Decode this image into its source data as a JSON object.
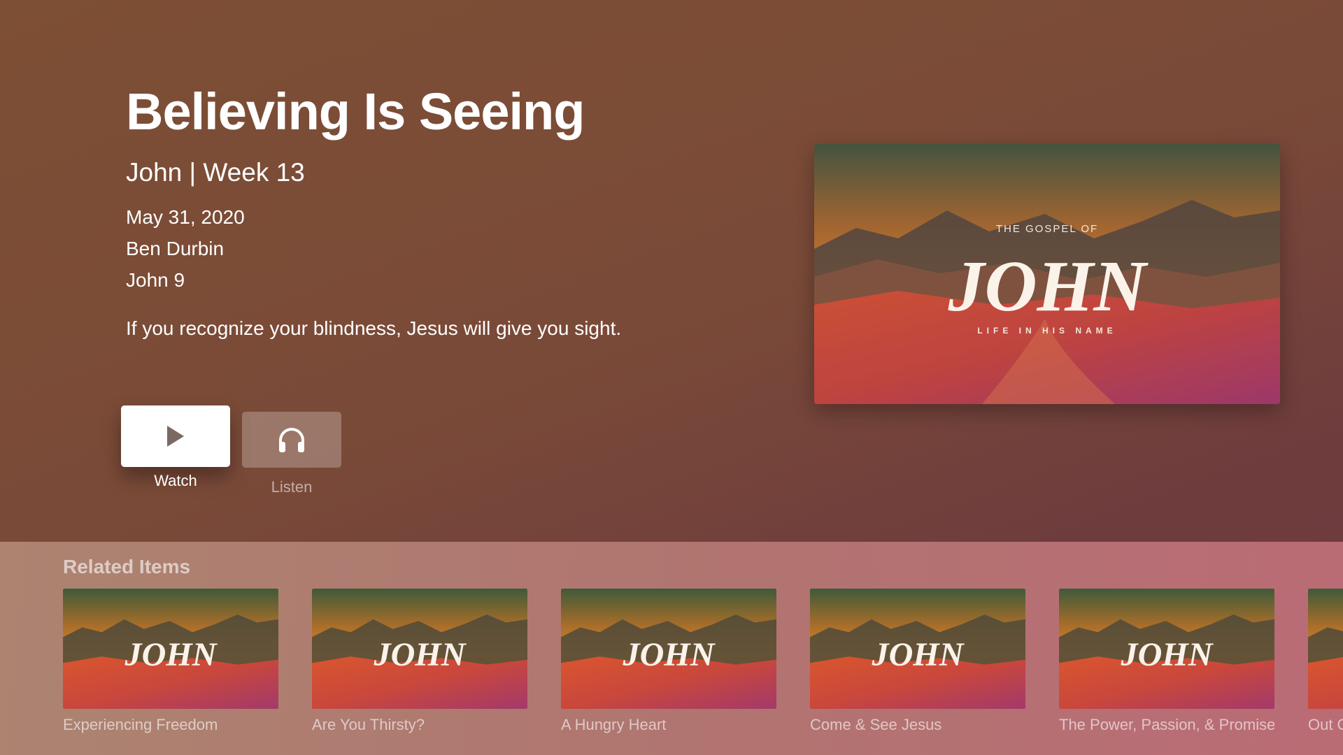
{
  "sermon": {
    "title": "Believing Is Seeing",
    "subtitle": "John | Week 13",
    "date": "May 31, 2020",
    "speaker": "Ben Durbin",
    "passage": "John 9",
    "description": "If you recognize your blindness, Jesus will give you sight."
  },
  "actions": {
    "watch_label": "Watch",
    "listen_label": "Listen",
    "watch_icon": "play-icon",
    "listen_icon": "headphones-icon"
  },
  "artwork": {
    "kicker": "THE GOSPEL OF",
    "title": "JOHN",
    "tagline": "LIFE IN HIS NAME"
  },
  "related": {
    "heading": "Related Items",
    "items": [
      {
        "caption": "Experiencing Freedom"
      },
      {
        "caption": "Are You Thirsty?"
      },
      {
        "caption": "A Hungry Heart"
      },
      {
        "caption": "Come & See Jesus"
      },
      {
        "caption": "The Power, Passion, & Promise"
      },
      {
        "caption": "Out Of"
      }
    ]
  },
  "colors": {
    "background": "#7a4a38",
    "button_focused": "#ffffff",
    "shelf": "#b88474"
  }
}
